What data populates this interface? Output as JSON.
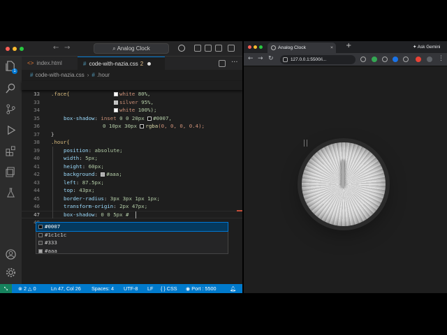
{
  "vscode": {
    "window_title": "Analog Clock",
    "tabs": [
      {
        "label": "index.html",
        "glyph": "<>"
      },
      {
        "label": "code-with-nazia.css",
        "glyph": "#",
        "badge": "2"
      }
    ],
    "breadcrumb": {
      "file": "code-with-nazia.css",
      "symbol": ".hour"
    },
    "sticky_scroll": {
      "line": "13",
      "selector": ".face{"
    },
    "activity_badge": "1",
    "lines": [
      {
        "n": "32",
        "swatch": "#ffffff",
        "value": "white",
        "pct": "80%,"
      },
      {
        "n": "33",
        "swatch": "#c0c0c0",
        "value": "silver",
        "pct": "95%,"
      },
      {
        "n": "34",
        "swatch": "#ffffff",
        "value": "white",
        "pct": "100%);"
      },
      {
        "n": "35",
        "prop": "box-shadow",
        "kw": "inset",
        "num": "0 0 20px",
        "swatch": "#000000",
        "value": "#0007,"
      },
      {
        "n": "36",
        "num": "0 10px 30px",
        "swatch": "#000000",
        "fn": "rgba",
        "value": "(0, 0, 0, 0.4);"
      },
      {
        "n": "37",
        "text": "}"
      },
      {
        "n": "38",
        "text": ".hour{"
      },
      {
        "n": "39",
        "prop": "position",
        "value": "absolute;"
      },
      {
        "n": "40",
        "prop": "width",
        "value": "5px;"
      },
      {
        "n": "41",
        "prop": "height",
        "value": "60px;"
      },
      {
        "n": "42",
        "prop": "background",
        "swatch": "#aaaaaa",
        "value": "#aaa;"
      },
      {
        "n": "43",
        "prop": "left",
        "value": "87.5px;"
      },
      {
        "n": "44",
        "prop": "top",
        "value": "43px;"
      },
      {
        "n": "45",
        "prop": "border-radius",
        "value": "3px 3px 1px 1px;"
      },
      {
        "n": "46",
        "prop": "transform-origin",
        "value": "2px 47px;"
      },
      {
        "n": "47",
        "prop": "box-shadow",
        "value": "0 0 5px #"
      },
      {
        "n": "48",
        "text": ""
      }
    ],
    "suggestions": [
      {
        "label": "#0007",
        "swatch": "#000000"
      },
      {
        "label": "#1c1c1c",
        "swatch": "#1c1c1c"
      },
      {
        "label": "#333",
        "swatch": "#333333"
      },
      {
        "label": "#aaa",
        "swatch": "#aaaaaa"
      }
    ],
    "status": {
      "errors": "2",
      "warnings": "0",
      "position": "Ln 47, Col 26",
      "spaces": "Spaces: 4",
      "encoding": "UTF-8",
      "eol": "LF",
      "language": "CSS",
      "port": "Port : 5500"
    }
  },
  "browser": {
    "tab_title": "Analog Clock",
    "url": "127.0.0.1:5500/i...",
    "ask_gemini": "Ask Gemini"
  },
  "colors": {
    "accent": "#007acc",
    "selection": "#04395e"
  }
}
